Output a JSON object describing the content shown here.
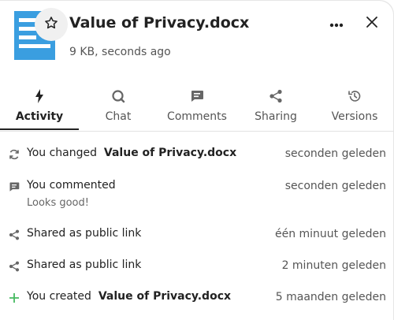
{
  "file": {
    "name": "Value of Privacy.docx",
    "meta": "9 KB, seconds ago"
  },
  "tabs": [
    {
      "label": "Activity",
      "icon": "lightning-icon"
    },
    {
      "label": "Chat",
      "icon": "chat-icon"
    },
    {
      "label": "Comments",
      "icon": "comment-icon"
    },
    {
      "label": "Sharing",
      "icon": "share-icon"
    },
    {
      "label": "Versions",
      "icon": "history-icon"
    }
  ],
  "activities": [
    {
      "icon": "sync-icon",
      "prefix": "You changed",
      "target": "Value of Privacy.docx",
      "time": "seconden geleden"
    },
    {
      "icon": "comment-icon",
      "prefix": "You commented",
      "target": "",
      "time": "seconden geleden",
      "sub": "Looks good!"
    },
    {
      "icon": "share-icon",
      "prefix": "Shared as public link",
      "target": "",
      "time": "één minuut geleden"
    },
    {
      "icon": "share-icon",
      "prefix": "Shared as public link",
      "target": "",
      "time": "2 minuten geleden"
    },
    {
      "icon": "plus-icon",
      "prefix": "You created",
      "target": "Value of Privacy.docx",
      "time": "5 maanden geleden"
    }
  ],
  "colors": {
    "file_icon": "#3a9ee0",
    "plus": "#46ba61"
  }
}
